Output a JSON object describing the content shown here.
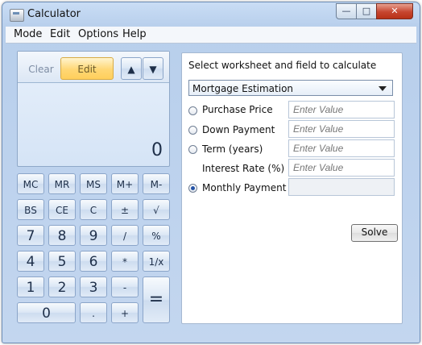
{
  "window": {
    "title": "Calculator",
    "caption_min": "—",
    "caption_max": "□",
    "caption_close": "✕"
  },
  "menu": [
    "Mode",
    "Edit",
    "Options",
    "Help"
  ],
  "display": {
    "clear_label": "Clear",
    "edit_label": "Edit",
    "up_arrow": "▲",
    "down_arrow": "▼",
    "value": "0"
  },
  "keypad": {
    "memory": [
      "MC",
      "MR",
      "MS",
      "M+",
      "M-"
    ],
    "row2": [
      "BS",
      "CE",
      "C",
      "±",
      "√"
    ],
    "row3": [
      "7",
      "8",
      "9",
      "/",
      "%"
    ],
    "row4": [
      "4",
      "5",
      "6",
      "*",
      "1/x"
    ],
    "row5": [
      "1",
      "2",
      "3",
      "-"
    ],
    "row6": [
      "0",
      ".",
      "+"
    ],
    "equals": "="
  },
  "worksheet": {
    "title": "Select worksheet and field to calculate",
    "selected": "Mortgage Estimation",
    "fields": [
      {
        "label": "Purchase Price",
        "placeholder": "Enter Value"
      },
      {
        "label": "Down Payment",
        "placeholder": "Enter Value"
      },
      {
        "label": "Term (years)",
        "placeholder": "Enter Value"
      },
      {
        "label": "Interest Rate (%)",
        "placeholder": "Enter Value"
      },
      {
        "label": "Monthly Payment",
        "placeholder": ""
      }
    ],
    "solve_label": "Solve"
  }
}
